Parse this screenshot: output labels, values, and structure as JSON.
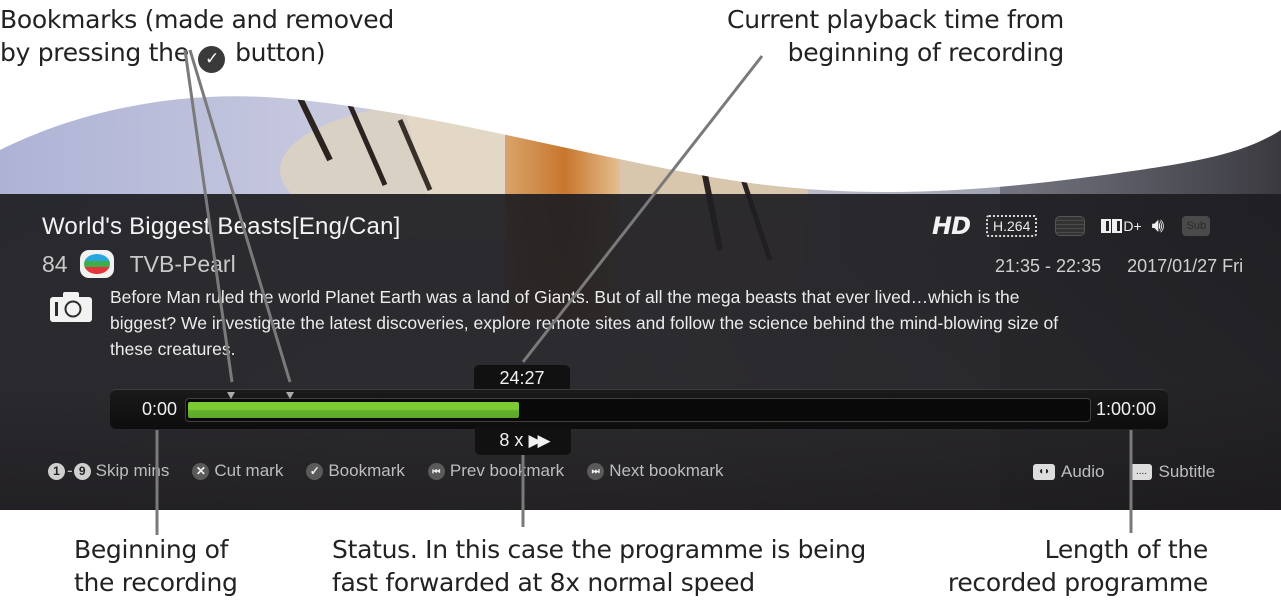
{
  "annotations": {
    "bookmarks": [
      "Bookmarks (made and removed",
      "by pressing the",
      "button)"
    ],
    "bookmarks_icon": "check-circle-icon",
    "current_time": [
      "Current playback time from",
      "beginning of recording"
    ],
    "beginning": [
      "Beginning of",
      "the recording"
    ],
    "status": [
      "Status. In this case the programme is being",
      "fast forwarded at 8x normal speed"
    ],
    "length": [
      "Length of the",
      "recorded programme"
    ]
  },
  "programme": {
    "title": "World's Biggest Beasts[Eng/Can]",
    "channel_number": "84",
    "channel_name": "TVB-Pearl",
    "time_range": "21:35 - 22:35",
    "date": "2017/01/27 Fri",
    "description": "Before Man ruled the world Planet Earth was a land of Giants. But of all the mega beasts that ever lived…which is the biggest? We investigate the latest discoveries, explore remote sites and follow the science behind the mind-blowing size of these creatures."
  },
  "badges": {
    "hd": "HD",
    "codec": "H.264",
    "teletext": "teletext-icon",
    "dolby": "D+",
    "audio": "speaker-icon",
    "subtitle": "Sub"
  },
  "playback": {
    "start": "0:00",
    "end": "1:00:00",
    "current": "24:27",
    "progress_fraction": 0.3675,
    "bookmarks_fraction": [
      0.048,
      0.113
    ],
    "speed": "8 x",
    "status_icon": "fast-forward-icon"
  },
  "hints": [
    {
      "icon": "1",
      "icon2": "9",
      "label": "Skip mins"
    },
    {
      "icon": "✕",
      "label": "Cut mark"
    },
    {
      "icon": "✓",
      "label": "Bookmark"
    },
    {
      "icon": "⏮",
      "label": "Prev bookmark"
    },
    {
      "icon": "⏭",
      "label": "Next bookmark"
    }
  ],
  "hints_right": [
    {
      "icon": "audio-icon",
      "label": "Audio"
    },
    {
      "icon": "subtitle-icon",
      "label": "Subtitle"
    }
  ],
  "colors": {
    "progress": "#7dcb33",
    "osd_bg": "#222226"
  }
}
